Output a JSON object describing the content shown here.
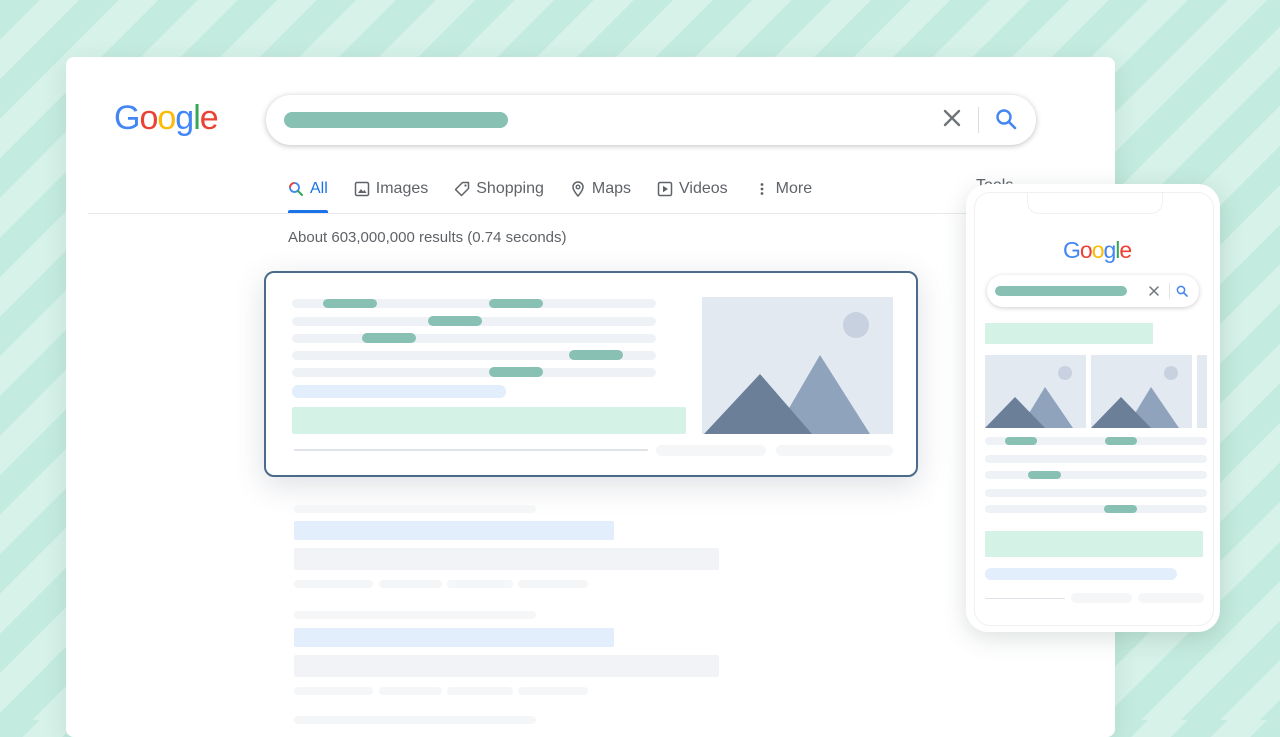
{
  "logo": {
    "letters": [
      "G",
      "o",
      "o",
      "g",
      "l",
      "e"
    ],
    "colors": [
      "#4285f4",
      "#ea4335",
      "#fbbc05",
      "#4285f4",
      "#34a853",
      "#ea4335"
    ]
  },
  "search": {
    "clear_icon": "close-icon",
    "search_icon": "search-icon"
  },
  "tabs": [
    {
      "label": "All",
      "icon": "search-icon"
    },
    {
      "label": "Images",
      "icon": "image-icon"
    },
    {
      "label": "Shopping",
      "icon": "tag-icon"
    },
    {
      "label": "Maps",
      "icon": "map-pin-icon"
    },
    {
      "label": "Videos",
      "icon": "play-icon"
    },
    {
      "label": "More",
      "icon": "more-vert-icon"
    }
  ],
  "tools_label": "Tools",
  "result_stats": "About 603,000,000 results (0.74 seconds)",
  "colors": {
    "accent": "#1a73e8",
    "placeholder_teal": "#88c0b4",
    "card_border": "#4c6b8a",
    "background_mint": "#cdeee3"
  }
}
